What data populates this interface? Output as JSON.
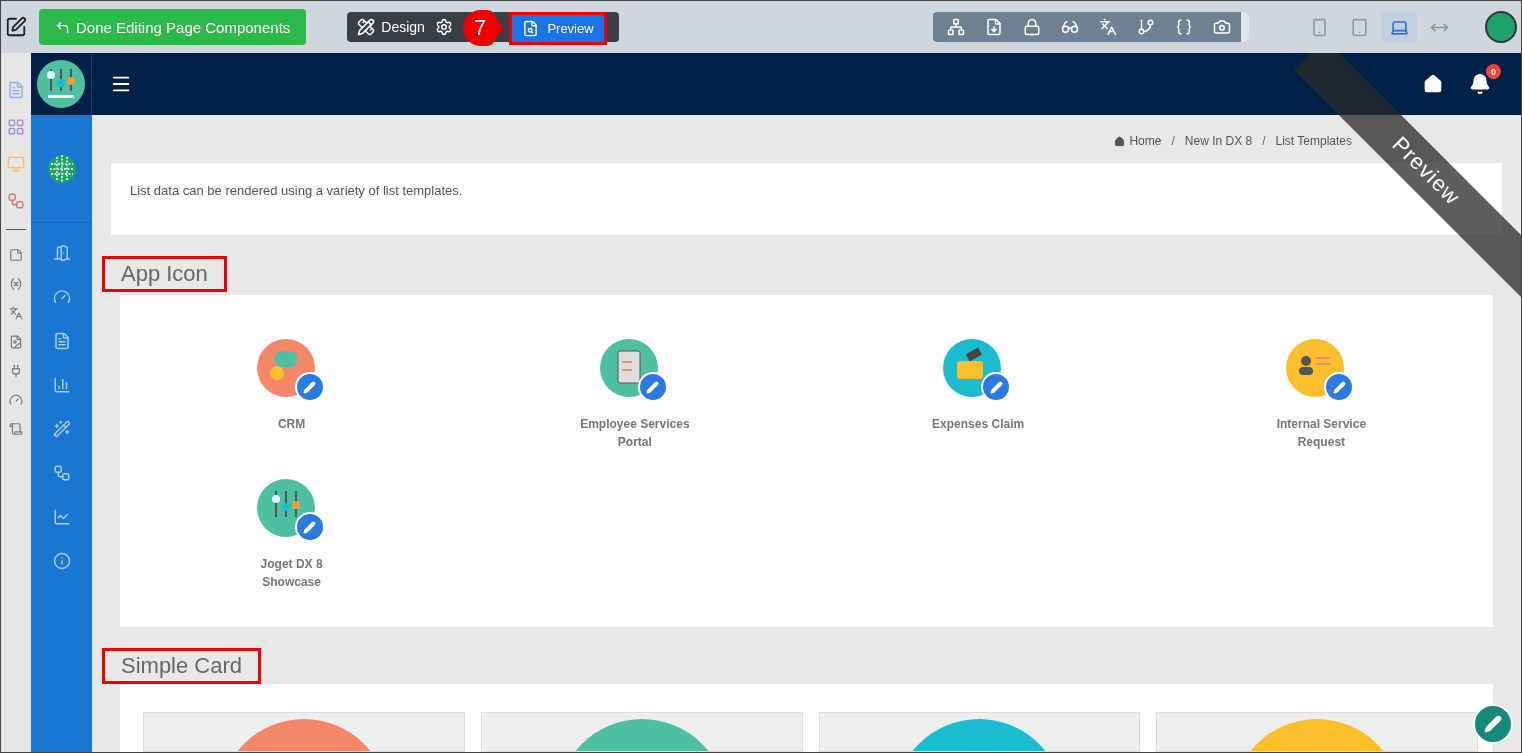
{
  "top_bar": {
    "done_button": "Done Editing Page Components",
    "design_button": "Design",
    "preview_button": "Preview",
    "step_marker": "7",
    "tools": [
      {
        "kind": "sitemap"
      },
      {
        "kind": "export"
      },
      {
        "kind": "lock"
      },
      {
        "kind": "binoculars"
      },
      {
        "kind": "translate"
      },
      {
        "kind": "branch"
      },
      {
        "kind": "braces"
      },
      {
        "kind": "camera"
      }
    ],
    "devices": [
      {
        "kind": "phone",
        "selected": false
      },
      {
        "kind": "tablet",
        "selected": false
      },
      {
        "kind": "laptop",
        "selected": true
      },
      {
        "kind": "fluid",
        "selected": false
      }
    ]
  },
  "builder_strip": [
    {
      "kind": "form",
      "color": "#8ab4f0"
    },
    {
      "kind": "list",
      "color": "#a98fd8"
    },
    {
      "kind": "ui",
      "color": "#f2c55c"
    },
    {
      "kind": "process",
      "color": "#e57373"
    },
    {
      "kind": "divider"
    },
    {
      "kind": "note"
    },
    {
      "kind": "variable"
    },
    {
      "kind": "translate"
    },
    {
      "kind": "file"
    },
    {
      "kind": "plugin"
    },
    {
      "kind": "gauge"
    },
    {
      "kind": "scroll"
    }
  ],
  "sidebar": {
    "items": [
      {
        "kind": "door"
      },
      {
        "kind": "dashboard"
      },
      {
        "kind": "document"
      },
      {
        "kind": "bar-chart"
      },
      {
        "kind": "wand"
      },
      {
        "kind": "workflow"
      },
      {
        "kind": "line-chart"
      },
      {
        "kind": "info"
      }
    ]
  },
  "header": {
    "notification_count": "0",
    "ribbon": "Preview"
  },
  "breadcrumb": [
    "Home",
    "New In DX 8",
    "List Templates"
  ],
  "breadcrumb_separator": "/",
  "intro": "List data can be rendered using a variety of list templates.",
  "sections": [
    {
      "title": "App Icon",
      "apps": [
        {
          "name": "CRM",
          "color": "#f4876a",
          "kind": "chat"
        },
        {
          "name": "Employee Services Portal",
          "color": "#4cc0a0",
          "kind": "clipboard"
        },
        {
          "name": "Expenses Claim",
          "color": "#1bbccf",
          "kind": "wallet"
        },
        {
          "name": "Internal Service Request",
          "color": "#fbbf2c",
          "kind": "person"
        },
        {
          "name": "Joget DX 8 Showcase",
          "color": "#4cc0a0",
          "kind": "sliders"
        }
      ]
    },
    {
      "title": "Simple Card",
      "cards": [
        {
          "color": "#f4876a"
        },
        {
          "color": "#4cc0a0"
        },
        {
          "color": "#1bbccf"
        },
        {
          "color": "#fbbf2c"
        }
      ]
    }
  ]
}
